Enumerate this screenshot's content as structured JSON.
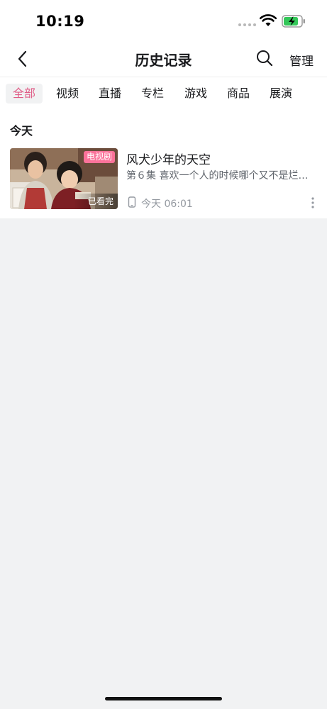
{
  "status_bar": {
    "time": "10:19"
  },
  "nav": {
    "title": "历史记录",
    "manage_label": "管理"
  },
  "tabs": [
    {
      "label": "全部",
      "active": true
    },
    {
      "label": "视频",
      "active": false
    },
    {
      "label": "直播",
      "active": false
    },
    {
      "label": "专栏",
      "active": false
    },
    {
      "label": "游戏",
      "active": false
    },
    {
      "label": "商品",
      "active": false
    },
    {
      "label": "展演",
      "active": false
    }
  ],
  "section": {
    "label": "今天"
  },
  "history_items": [
    {
      "title": "风犬少年的天空",
      "subtitle": "第６集 喜欢一个人的时候哪个又不是烂…",
      "badge": "电视剧",
      "watched": "已看完",
      "time": "今天 06:01"
    }
  ],
  "colors": {
    "accent": "#e05c86",
    "badge": "#fb7299",
    "page_bg": "#f1f2f3"
  }
}
